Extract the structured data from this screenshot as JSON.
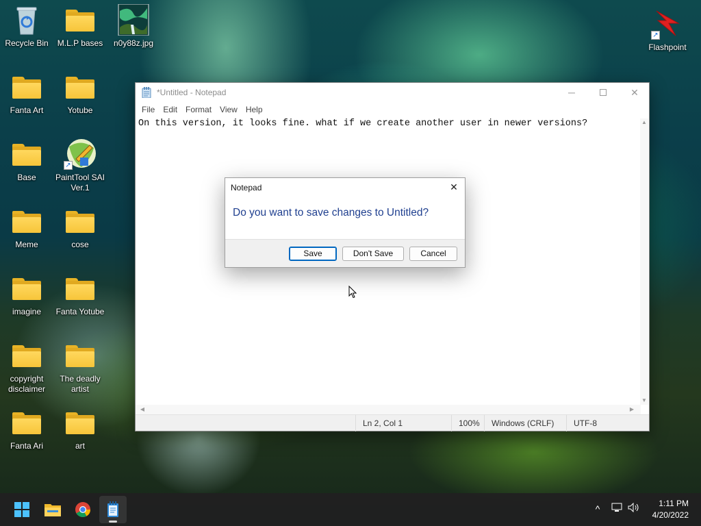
{
  "desktop": {
    "icons": [
      {
        "label": "Recycle Bin"
      },
      {
        "label": "M.L.P bases"
      },
      {
        "label": "n0y88z.jpg"
      },
      {
        "label": "Flashpoint"
      },
      {
        "label": "Fanta Art"
      },
      {
        "label": "Yotube"
      },
      {
        "label": "Base"
      },
      {
        "label": "PaintTool SAI Ver.1"
      },
      {
        "label": "Meme"
      },
      {
        "label": "cose"
      },
      {
        "label": "imagine"
      },
      {
        "label": "Fanta Yotube"
      },
      {
        "label": "copyright disclaimer"
      },
      {
        "label": "The deadly artist"
      },
      {
        "label": "Fanta Ari"
      },
      {
        "label": "art"
      }
    ]
  },
  "notepad": {
    "title": "*Untitled - Notepad",
    "menu": [
      "File",
      "Edit",
      "Format",
      "View",
      "Help"
    ],
    "content": "On this version, it looks fine. what if we create another user in newer versions?",
    "status": {
      "position": "Ln 2, Col 1",
      "zoom": "100%",
      "line_ending": "Windows (CRLF)",
      "encoding": "UTF-8"
    }
  },
  "dialog": {
    "title": "Notepad",
    "message": "Do you want to save changes to Untitled?",
    "buttons": {
      "save": "Save",
      "dont_save": "Don't Save",
      "cancel": "Cancel"
    }
  },
  "taskbar": {
    "time": "1:11 PM",
    "date": "4/20/2022"
  },
  "colors": {
    "accent": "#0067c0",
    "dialog_message": "#1f3f8f",
    "folder": "#f7c53a"
  }
}
